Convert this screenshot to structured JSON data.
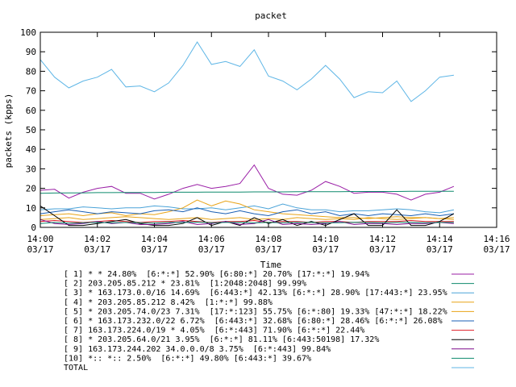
{
  "chart_data": {
    "type": "line",
    "title": "packet",
    "xlabel": "Time",
    "ylabel": "packets (kpps)",
    "ylim": [
      0,
      100
    ],
    "yticks": [
      0,
      10,
      20,
      30,
      40,
      50,
      60,
      70,
      80,
      90,
      100
    ],
    "grid": false,
    "legend_placement": "bottom",
    "x_ticks": [
      {
        "time": "14:00",
        "date": "03/17"
      },
      {
        "time": "14:02",
        "date": "03/17"
      },
      {
        "time": "14:04",
        "date": "03/17"
      },
      {
        "time": "14:06",
        "date": "03/17"
      },
      {
        "time": "14:08",
        "date": "03/17"
      },
      {
        "time": "14:10",
        "date": "03/17"
      },
      {
        "time": "14:12",
        "date": "03/17"
      },
      {
        "time": "14:14",
        "date": "03/17"
      },
      {
        "time": "14:16",
        "date": "03/17"
      }
    ],
    "x_minutes": [
      0,
      0.5,
      1,
      1.5,
      2,
      2.5,
      3,
      3.5,
      4,
      4.5,
      5,
      5.5,
      6,
      6.5,
      7,
      7.5,
      8,
      8.5,
      9,
      9.5,
      10,
      10.5,
      11,
      11.5,
      12,
      12.5,
      13,
      13.5,
      14,
      14.5
    ],
    "series": [
      {
        "label": "[ 1] * * 24.80%  [6:*:*] 52.90% [6:80:*] 20.70% [17:*:*] 19.94%",
        "color": "#9a1ea6",
        "values": [
          19,
          19.5,
          15,
          18,
          20,
          21,
          17.5,
          17.5,
          14.5,
          17,
          20,
          22,
          20,
          21,
          22.5,
          32,
          20,
          17,
          16.5,
          19,
          23.5,
          21,
          17.5,
          18,
          18,
          17,
          14,
          17,
          18,
          21
        ]
      },
      {
        "label": "[ 2] 203.205.85.212 * 23.81%  [1:2048:2048] 99.99%",
        "color": "#0e8a6d",
        "values": [
          17.5,
          17.6,
          17.7,
          17.7,
          17.8,
          17.8,
          17.9,
          17.9,
          17.9,
          18,
          18,
          18,
          18.1,
          18.1,
          18.1,
          18.2,
          18.2,
          18.2,
          18.3,
          18.3,
          18.3,
          18.3,
          18.4,
          18.4,
          18.4,
          18.4,
          18.5,
          18.5,
          18.5,
          18.5
        ]
      },
      {
        "label": "[ 3] * 163.173.0.0/16 14.69%  [6:443:*] 42.13% [6:*:*] 28.90% [17:443:*] 23.95%",
        "color": "#4aa3d8",
        "values": [
          9,
          9.5,
          9.5,
          10.5,
          10,
          9.5,
          10,
          10,
          11,
          10.5,
          9.5,
          9.5,
          10,
          9,
          10,
          11,
          9.5,
          12,
          10,
          9,
          9,
          8,
          8.5,
          8.5,
          9,
          9.5,
          9,
          8,
          7.5,
          9
        ]
      },
      {
        "label": "[ 4] * 203.205.85.212 8.42%  [1:*:*] 99.88%",
        "color": "#e8a317",
        "values": [
          6,
          6.5,
          7,
          6,
          7,
          7.5,
          6,
          7,
          6.5,
          8,
          10,
          14,
          11,
          13.5,
          12,
          9,
          8,
          7,
          6.5,
          6,
          5.5,
          5,
          5,
          4.5,
          5,
          5.5,
          5,
          5,
          4.5,
          5
        ]
      },
      {
        "label": "[ 5] * 203.205.74.0/23 7.31%  [17:*:123] 55.75% [6:*:80] 19.33% [47:*:*] 18.22%",
        "color": "#e8a317",
        "values": [
          4,
          4.5,
          5,
          4,
          4.5,
          5,
          5.5,
          5,
          4.5,
          4,
          4.5,
          5,
          4,
          4.5,
          5,
          4,
          4.5,
          4,
          5,
          4.5,
          4,
          4.5,
          4,
          5,
          4.5,
          4,
          4.5,
          5,
          4.5,
          4
        ]
      },
      {
        "label": "[ 6] * 163.173.232.0/22 6.72%  [6:443:*] 32.68% [6:80:*] 28.46% [6:*:*] 26.08%",
        "color": "#1a5fb4",
        "values": [
          7,
          8,
          9,
          8,
          7,
          8,
          7.5,
          7,
          8.5,
          9,
          8,
          10,
          8,
          7,
          8.5,
          7,
          6,
          8,
          9,
          7,
          8,
          6,
          7,
          6,
          7,
          6.5,
          6,
          7,
          6,
          7
        ]
      },
      {
        "label": "[ 7] 163.173.224.0/19 * 4.05%  [6:*:443] 71.90% [6:*:*] 22.44%",
        "color": "#e01b24",
        "values": [
          3,
          3.5,
          3,
          2.5,
          3,
          3.5,
          3,
          2.5,
          3,
          3,
          3.5,
          3,
          2.5,
          3,
          3,
          3.5,
          2.5,
          3,
          3,
          2.5,
          3,
          3,
          2.5,
          3,
          3,
          3,
          3.5,
          3,
          3,
          3
        ]
      },
      {
        "label": "[ 8] * 203.205.64.0/21 3.95%  [6:*:*] 81.11% [6:443:50198] 17.32%",
        "color": "#000000",
        "values": [
          11,
          6,
          1,
          1,
          2,
          3,
          4,
          2,
          1,
          1,
          2,
          5,
          1,
          3,
          1,
          5,
          2,
          4,
          1,
          3,
          1,
          4,
          7,
          1,
          1,
          9,
          1,
          1,
          3,
          7
        ]
      },
      {
        "label": "[ 9] 163.173.244.202 34.0.0.0/8 3.75%  [6:*:443] 99.84%",
        "color": "#7d0a8c",
        "values": [
          4,
          2,
          1.5,
          2,
          3,
          2,
          2.5,
          1.5,
          1.5,
          2,
          3,
          1.5,
          2,
          3,
          1.5,
          2,
          4,
          1.5,
          2,
          1.5,
          2,
          3,
          1.5,
          2,
          2,
          1.5,
          2,
          2,
          2.5,
          2
        ]
      },
      {
        "label": "[10] *:: *:: 2.50%  [6:*:*] 49.80% [6:443:*] 39.67%",
        "color": "#0e8a6d",
        "values": [
          2,
          2.5,
          2.2,
          2.4,
          2.6,
          2.3,
          2.5,
          2.4,
          2.2,
          2.6,
          2.5,
          2.7,
          2.4,
          2.5,
          2.6,
          2.3,
          2.5,
          2.4,
          2.6,
          2.5,
          2.3,
          2.4,
          2.6,
          2.5,
          2.4,
          2.5,
          2.6,
          2.4,
          2.5,
          2.5
        ]
      },
      {
        "label": "TOTAL",
        "color": "#5fb6e6",
        "values": [
          86,
          77,
          71.5,
          75,
          77,
          81,
          72,
          72.5,
          69.5,
          74,
          83,
          95,
          83.5,
          85,
          82.5,
          91,
          77.5,
          75,
          70.5,
          76,
          83,
          76,
          66.5,
          69.5,
          69,
          75,
          64.5,
          70,
          77,
          78
        ]
      }
    ]
  }
}
